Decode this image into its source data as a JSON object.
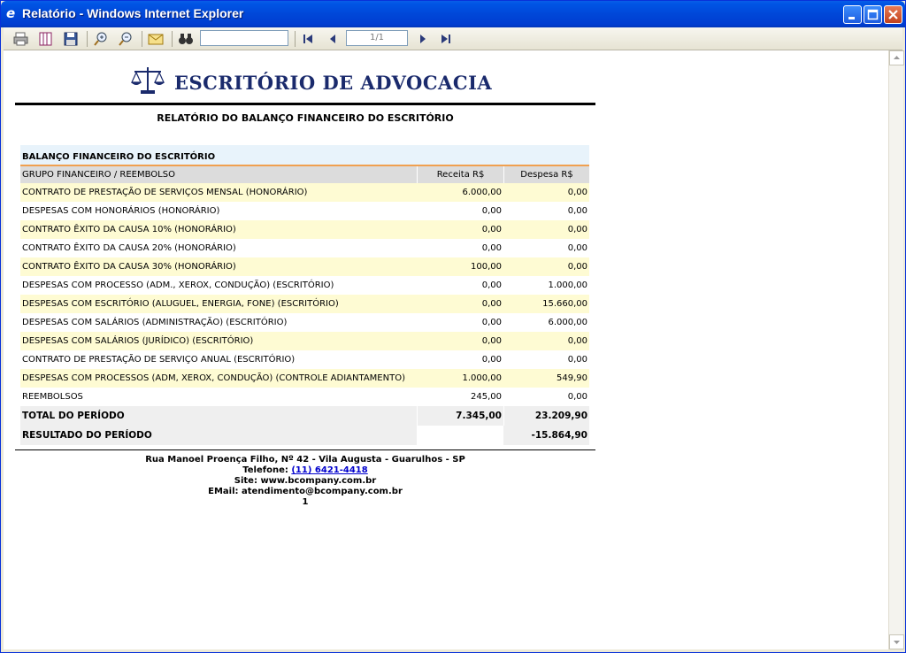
{
  "window": {
    "title": "Relatório - Windows Internet Explorer"
  },
  "toolbar": {
    "find_value": "",
    "page_indicator": "1/1"
  },
  "report": {
    "brand": "ESCRITÓRIO DE ADVOCACIA",
    "title": "RELATÓRIO DO BALANÇO FINANCEIRO DO ESCRITÓRIO",
    "section_title": "BALANÇO FINANCEIRO DO ESCRITÓRIO",
    "columns": {
      "group": "GRUPO FINANCEIRO / REEMBOLSO",
      "income": "Receita R$",
      "expense": "Despesa R$"
    },
    "rows": [
      {
        "label": "CONTRATO DE PRESTAÇÃO DE SERVIÇOS MENSAL (HONORÁRIO)",
        "income": "6.000,00",
        "expense": "0,00"
      },
      {
        "label": "DESPESAS COM HONORÁRIOS (HONORÁRIO)",
        "income": "0,00",
        "expense": "0,00"
      },
      {
        "label": "CONTRATO ÊXITO DA CAUSA 10% (HONORÁRIO)",
        "income": "0,00",
        "expense": "0,00"
      },
      {
        "label": "CONTRATO ÊXITO DA CAUSA 20% (HONORÁRIO)",
        "income": "0,00",
        "expense": "0,00"
      },
      {
        "label": "CONTRATO ÊXITO DA CAUSA 30% (HONORÁRIO)",
        "income": "100,00",
        "expense": "0,00"
      },
      {
        "label": "DESPESAS COM PROCESSO (ADM., XEROX, CONDUÇÃO) (ESCRITÓRIO)",
        "income": "0,00",
        "expense": "1.000,00"
      },
      {
        "label": "DESPESAS COM ESCRITÓRIO (ALUGUEL, ENERGIA, FONE) (ESCRITÓRIO)",
        "income": "0,00",
        "expense": "15.660,00"
      },
      {
        "label": "DESPESAS COM SALÁRIOS (ADMINISTRAÇÃO) (ESCRITÓRIO)",
        "income": "0,00",
        "expense": "6.000,00"
      },
      {
        "label": "DESPESAS COM SALÁRIOS (JURÍDICO) (ESCRITÓRIO)",
        "income": "0,00",
        "expense": "0,00"
      },
      {
        "label": "CONTRATO DE PRESTAÇÃO DE SERVIÇO ANUAL (ESCRITÓRIO)",
        "income": "0,00",
        "expense": "0,00"
      },
      {
        "label": "DESPESAS COM PROCESSOS (ADM, XEROX, CONDUÇÃO) (CONTROLE ADIANTAMENTO)",
        "income": "1.000,00",
        "expense": "549,90"
      },
      {
        "label": "REEMBOLSOS",
        "income": "245,00",
        "expense": "0,00"
      }
    ],
    "total": {
      "label": "TOTAL DO PERÍODO",
      "income": "7.345,00",
      "expense": "23.209,90"
    },
    "result": {
      "label": "RESULTADO DO PERÍODO",
      "value": "-15.864,90"
    },
    "footer": {
      "address": "Rua Manoel Proença Filho, Nº 42 - Vila Augusta - Guarulhos - SP",
      "phone_label": "Telefone:",
      "phone": "(11) 6421-4418",
      "site": "Site: www.bcompany.com.br",
      "email": "EMail: atendimento@bcompany.com.br",
      "page_number": "1"
    }
  },
  "colors": {
    "row_highlight": "#fefbd3",
    "section_bg": "#e8f3fb",
    "section_border": "#f0a050",
    "brand": "#1a2a6c"
  }
}
